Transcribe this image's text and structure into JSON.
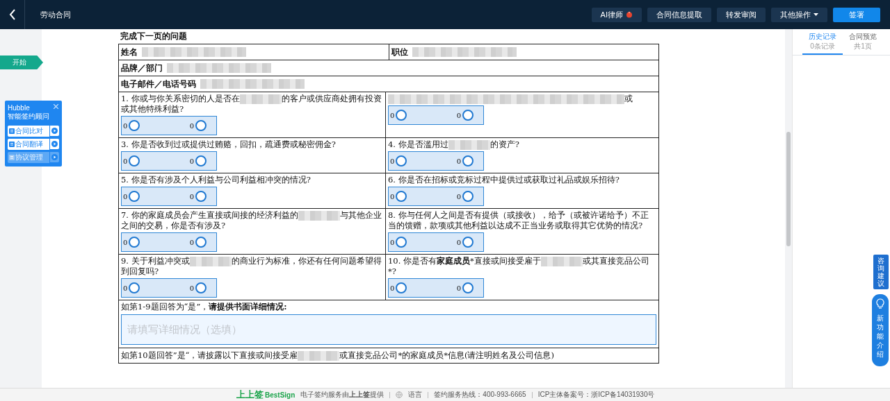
{
  "topbar": {
    "title": "劳动合同",
    "buttons": [
      {
        "label": "AI律师",
        "kind": "ai"
      },
      {
        "label": "合同信息提取",
        "kind": "plain"
      },
      {
        "label": "转发审阅",
        "kind": "plain"
      },
      {
        "label": "其他操作",
        "kind": "menu"
      },
      {
        "label": "签署",
        "kind": "primary"
      }
    ]
  },
  "start_tag": "开始",
  "assistant": {
    "title": "Hubble",
    "subtitle": "智能签约顾问",
    "items": [
      {
        "label": "合同比对",
        "disabled": false
      },
      {
        "label": "合同翻译",
        "disabled": false
      },
      {
        "label": "协议管理",
        "disabled": true
      }
    ]
  },
  "document": {
    "heading": "完成下一页的问题",
    "info_rows": [
      [
        {
          "label": "姓名",
          "redacted": true
        },
        {
          "label": "职位",
          "redacted": true
        }
      ],
      [
        {
          "label": "品牌／部门",
          "redacted": true
        }
      ],
      [
        {
          "label": "电子邮件／电话号码",
          "redacted": true
        }
      ]
    ],
    "question_rows": [
      [
        {
          "parts": [
            {
              "kind": "text",
              "text": "1. 你或与你关系密切的人是否在"
            },
            {
              "kind": "redacted"
            },
            {
              "kind": "text",
              "text": "的客户或供应商处拥有投资或其他特殊利益?"
            }
          ],
          "options": [
            {
              "label": "0",
              "selected": false
            },
            {
              "label": "0",
              "selected": false
            }
          ]
        },
        {
          "parts": [
            {
              "kind": "redacted_long"
            },
            {
              "kind": "text",
              "text": "或"
            }
          ],
          "options": [
            {
              "label": "0",
              "selected": false
            },
            {
              "label": "0",
              "selected": false
            }
          ]
        }
      ],
      [
        {
          "parts": [
            {
              "kind": "text",
              "text": "3. 你是否收到过或提供过贿赂，回扣，疏通费或秘密佣金?"
            }
          ],
          "options": [
            {
              "label": "0",
              "selected": false
            },
            {
              "label": "0",
              "selected": false
            }
          ]
        },
        {
          "parts": [
            {
              "kind": "text",
              "text": "4. 你是否滥用过"
            },
            {
              "kind": "redacted"
            },
            {
              "kind": "text",
              "text": "的资产?"
            }
          ],
          "options": [
            {
              "label": "0",
              "selected": false
            },
            {
              "label": "0",
              "selected": false
            }
          ]
        }
      ],
      [
        {
          "parts": [
            {
              "kind": "text",
              "text": "5. 你是否有涉及个人利益与公司利益相冲突的情况?"
            }
          ],
          "options": [
            {
              "label": "0",
              "selected": false
            },
            {
              "label": "0",
              "selected": false
            }
          ]
        },
        {
          "parts": [
            {
              "kind": "text",
              "text": "6.  你是否在招标或竞标过程中提供过或获取过礼品或娱乐招待?"
            }
          ],
          "options": [
            {
              "label": "0",
              "selected": false
            },
            {
              "label": "0",
              "selected": false
            }
          ]
        }
      ],
      [
        {
          "parts": [
            {
              "kind": "text",
              "text": "7. 你的家庭成员会产生直接或间接的经济利益的"
            },
            {
              "kind": "redacted"
            },
            {
              "kind": "text",
              "text": "与其他企业之间的交易，你是否有涉及?"
            }
          ],
          "options": [
            {
              "label": "0",
              "selected": false
            },
            {
              "label": "0",
              "selected": false
            }
          ]
        },
        {
          "parts": [
            {
              "kind": "text",
              "text": "8. 你与任何人之间是否有提供（或接收），给予（或被许诺给予）不正当的馈赠，款项或其他利益以达成不正当业务或取得其它优势的情况?"
            }
          ],
          "options": [
            {
              "label": "0",
              "selected": false
            },
            {
              "label": "0",
              "selected": false
            }
          ]
        }
      ],
      [
        {
          "parts": [
            {
              "kind": "text",
              "text": "9. 关于利益冲突或"
            },
            {
              "kind": "redacted"
            },
            {
              "kind": "text",
              "text": "的商业行为标准，你还有任何问题希望得到回复吗?"
            }
          ],
          "options": [
            {
              "label": "0",
              "selected": false
            },
            {
              "label": "0",
              "selected": false
            }
          ]
        },
        {
          "parts": [
            {
              "kind": "text",
              "text": "10. 你是否有**家庭成员***直接或间接受雇于"
            },
            {
              "kind": "redacted"
            },
            {
              "kind": "text",
              "text": "或其直接竞品公司*?"
            }
          ],
          "options": [
            {
              "label": "0",
              "selected": false
            },
            {
              "label": "0",
              "selected": false
            }
          ]
        }
      ]
    ],
    "detail_prompt": "如第1-9题回答为“是”，**请提供书面详细情况:**",
    "detail_field": {
      "placeholder": "请填写详细情况（选填）"
    },
    "last_line": [
      {
        "kind": "text",
        "text": "如第10题回答”是“，请披露以下直接或间接受雇"
      },
      {
        "kind": "redacted"
      },
      {
        "kind": "text",
        "text": "或直接竞品公司*的家庭成员*信息(请注明姓名及公司信息)"
      }
    ]
  },
  "side_panel": {
    "tabs": [
      {
        "label": "历史记录",
        "sub": "0条记录",
        "selected": true
      },
      {
        "label": "合同预览",
        "sub": "共1页",
        "selected": false
      }
    ]
  },
  "float_buttons": {
    "feedback": "咨询建议",
    "features": "新功能介绍"
  },
  "footer": {
    "logo_cn": "上上签",
    "logo_en": "BestSign",
    "provider": "电子签约服务由**上上签**提供",
    "language": "语言",
    "hotline": "签约服务热线：400-993-6665",
    "icp": "ICP主体备案号：浙ICP备14031930号"
  }
}
